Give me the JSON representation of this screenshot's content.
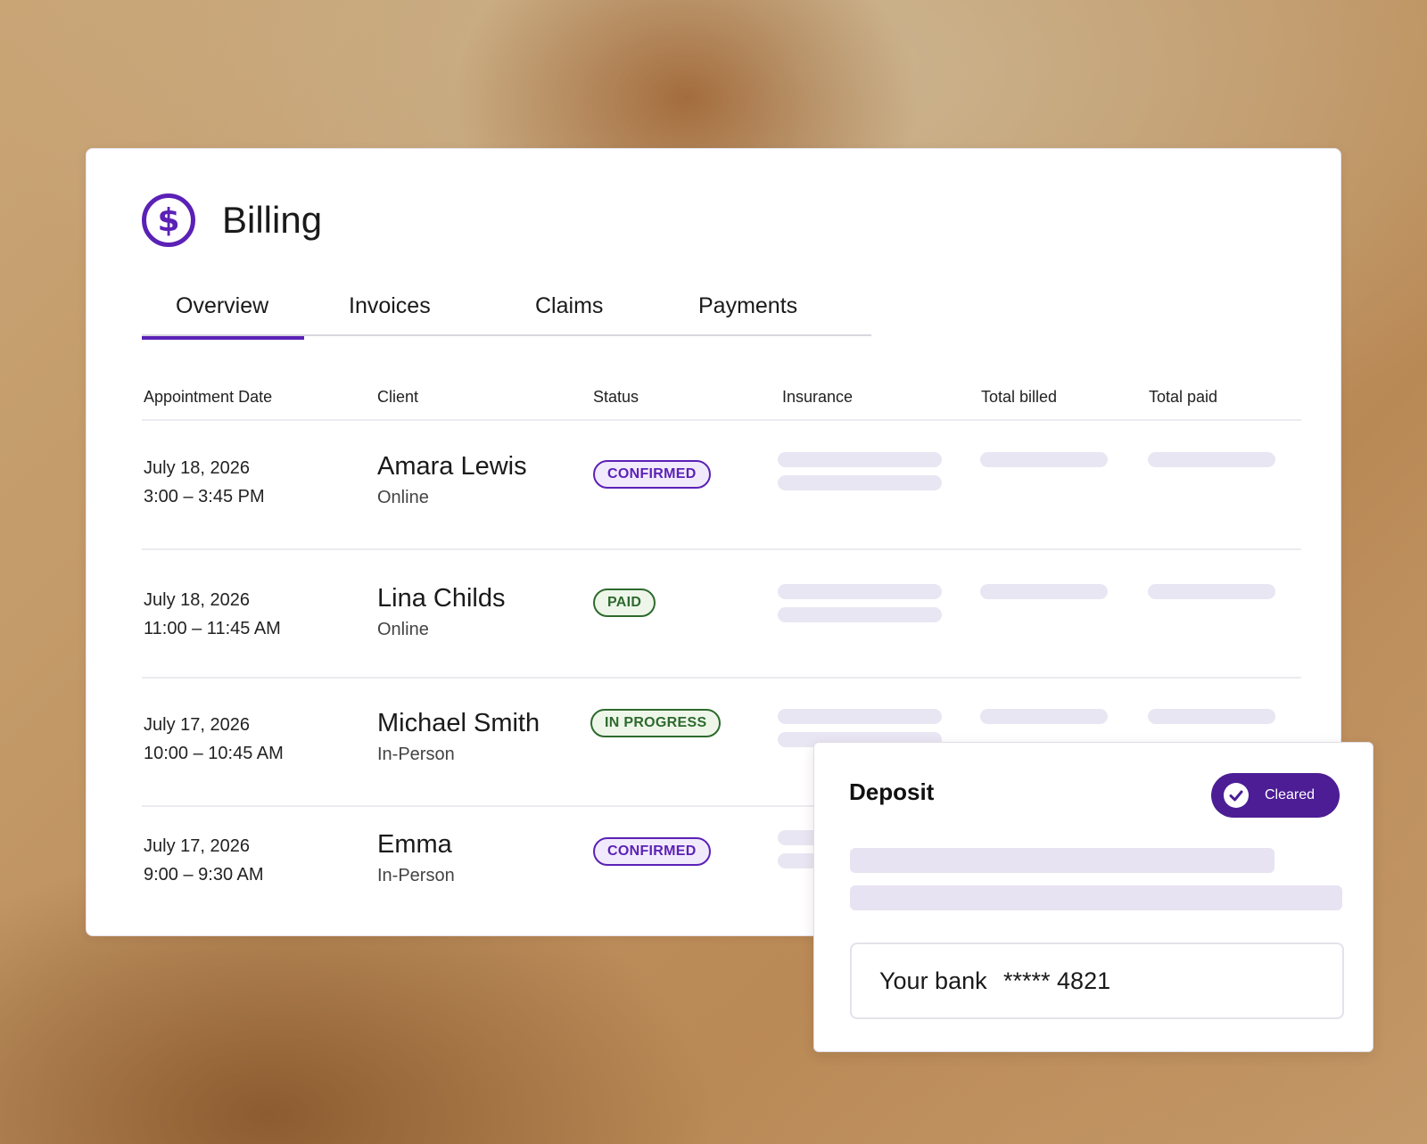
{
  "billing": {
    "title": "Billing",
    "icon": "dollar-circle-icon",
    "accent": "#5b21b6",
    "tabs": [
      {
        "label": "Overview",
        "active": true
      },
      {
        "label": "Invoices",
        "active": false
      },
      {
        "label": "Claims",
        "active": false
      },
      {
        "label": "Payments",
        "active": false
      }
    ],
    "columns": [
      "Appointment Date",
      "Client",
      "Status",
      "Insurance",
      "Total billed",
      "Total paid"
    ],
    "rows": [
      {
        "date": "July 18, 2026",
        "time": "3:00 – 3:45 PM",
        "client": "Amara Lewis",
        "type": "Online",
        "status": "CONFIRMED",
        "status_color": "purple"
      },
      {
        "date": "July 18, 2026",
        "time": "11:00 – 11:45 AM",
        "client": "Lina Childs",
        "type": "Online",
        "status": "PAID",
        "status_color": "green"
      },
      {
        "date": "July 17, 2026",
        "time": "10:00 – 10:45 AM",
        "client": "Michael Smith",
        "type": "In-Person",
        "status": "IN PROGRESS",
        "status_color": "green"
      },
      {
        "date": "July 17, 2026",
        "time": "9:00 – 9:30 AM",
        "client": "Emma",
        "type": "In-Person",
        "status": "CONFIRMED",
        "status_color": "purple"
      }
    ]
  },
  "deposit": {
    "title": "Deposit",
    "status_label": "Cleared",
    "status_icon": "check-icon",
    "bank_label": "Your bank",
    "account_masked": "***** 4821"
  }
}
